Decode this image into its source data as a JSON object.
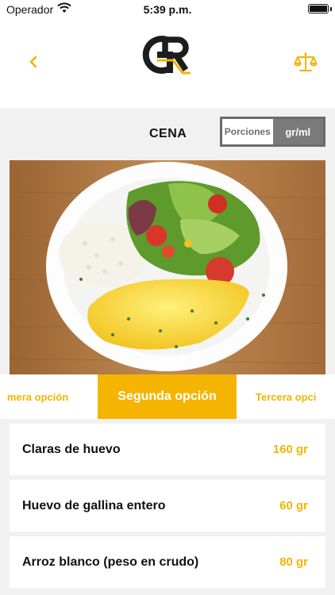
{
  "status_bar": {
    "carrier": "Operador",
    "time": "5:39 p.m."
  },
  "header": {
    "back_icon": "chevron-left-icon",
    "logo_icon": "gr-logo",
    "scale_icon": "balance-scale-icon",
    "accent_color": "#f4b400"
  },
  "meal": {
    "title": "CENA",
    "unit_toggle": {
      "options": [
        "Porciones",
        "gr/ml"
      ],
      "selected": "gr/ml"
    }
  },
  "tabs": {
    "prev": "mera opción",
    "current": "Segunda opción",
    "next": "Tercera opci"
  },
  "foods": [
    {
      "name": "Claras de huevo",
      "qty": "160 gr"
    },
    {
      "name": "Huevo de gallina entero",
      "qty": "60 gr"
    },
    {
      "name": "Arroz blanco (peso en crudo)",
      "qty": "80 gr"
    }
  ]
}
